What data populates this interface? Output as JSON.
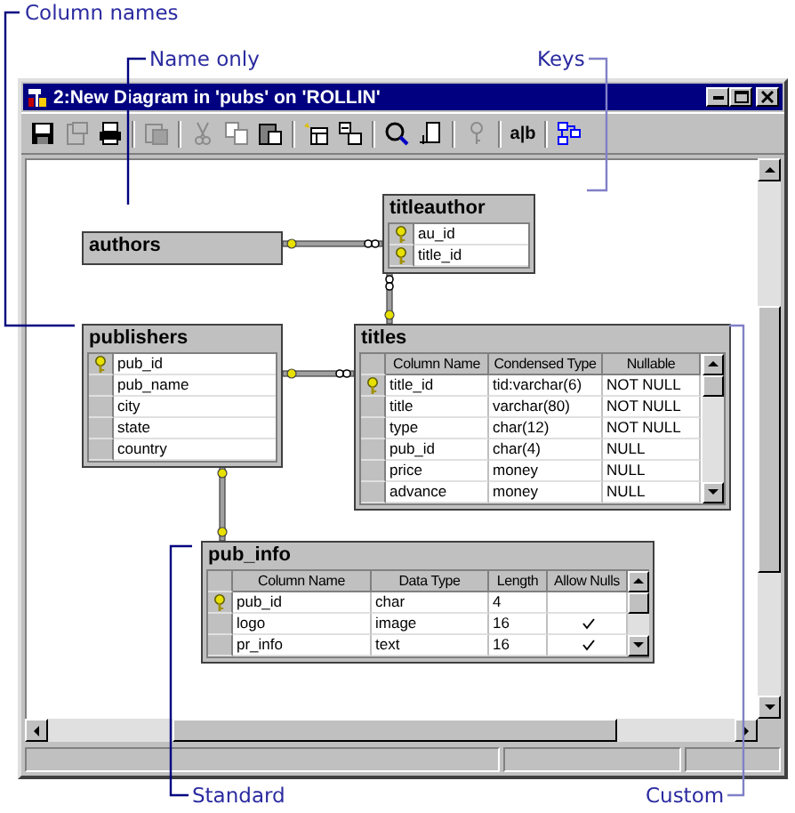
{
  "callouts": [
    {
      "text": "Column names"
    },
    {
      "text": "Name only"
    },
    {
      "text": "Keys"
    },
    {
      "text": "Standard"
    },
    {
      "text": "Custom"
    }
  ],
  "window": {
    "title": "2:New Diagram in 'pubs' on 'ROLLIN'"
  },
  "toolbar": [
    {
      "kind": "save",
      "disabled": false
    },
    {
      "kind": "properties",
      "disabled": true
    },
    {
      "kind": "print",
      "disabled": false
    },
    {
      "kind": "copy-diagram",
      "disabled": true
    },
    {
      "kind": "cut",
      "disabled": true
    },
    {
      "kind": "copy",
      "disabled": true
    },
    {
      "kind": "paste",
      "disabled": false
    },
    {
      "kind": "new-table",
      "disabled": false
    },
    {
      "kind": "add-table",
      "disabled": false
    },
    {
      "kind": "zoom",
      "disabled": false
    },
    {
      "kind": "layout",
      "disabled": false
    },
    {
      "kind": "key",
      "disabled": true
    },
    {
      "kind": "text",
      "label": "a|b",
      "disabled": false
    },
    {
      "kind": "relationships",
      "disabled": false
    }
  ],
  "tables": [
    {
      "name": "authors",
      "kind": "name_only"
    },
    {
      "name": "titleauthor",
      "kind": "keys",
      "rows": [
        {
          "key": true,
          "cells": [
            "au_id"
          ]
        },
        {
          "key": true,
          "cells": [
            "title_id"
          ]
        }
      ]
    },
    {
      "name": "publishers",
      "kind": "column_names",
      "rows": [
        {
          "key": true,
          "cells": [
            "pub_id"
          ]
        },
        {
          "key": false,
          "cells": [
            "pub_name"
          ]
        },
        {
          "key": false,
          "cells": [
            "city"
          ]
        },
        {
          "key": false,
          "cells": [
            "state"
          ]
        },
        {
          "key": false,
          "cells": [
            "country"
          ]
        }
      ]
    },
    {
      "name": "titles",
      "kind": "custom",
      "columns": [
        "Column Name",
        "Condensed Type",
        "Nullable"
      ],
      "rows": [
        {
          "key": true,
          "cells": [
            "title_id",
            "tid:varchar(6)",
            "NOT NULL"
          ]
        },
        {
          "key": false,
          "cells": [
            "title",
            "varchar(80)",
            "NOT NULL"
          ]
        },
        {
          "key": false,
          "cells": [
            "type",
            "char(12)",
            "NOT NULL"
          ]
        },
        {
          "key": false,
          "cells": [
            "pub_id",
            "char(4)",
            "NULL"
          ]
        },
        {
          "key": false,
          "cells": [
            "price",
            "money",
            "NULL"
          ]
        },
        {
          "key": false,
          "cells": [
            "advance",
            "money",
            "NULL"
          ]
        }
      ]
    },
    {
      "name": "pub_info",
      "kind": "standard",
      "columns": [
        "Column Name",
        "Data Type",
        "Length",
        "Allow Nulls"
      ],
      "rows": [
        {
          "key": true,
          "cells": [
            "pub_id",
            "char",
            "4"
          ],
          "allow_nulls": false
        },
        {
          "key": false,
          "cells": [
            "logo",
            "image",
            "16"
          ],
          "allow_nulls": true
        },
        {
          "key": false,
          "cells": [
            "pr_info",
            "text",
            "16"
          ],
          "allow_nulls": true
        }
      ]
    }
  ]
}
